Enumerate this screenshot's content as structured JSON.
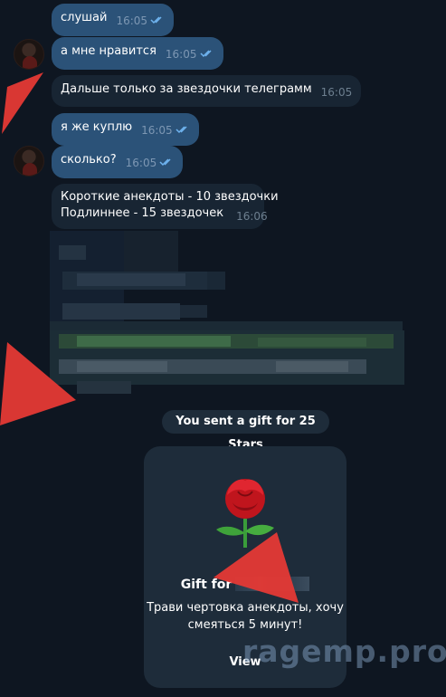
{
  "messages": [
    {
      "text": "слушай",
      "time": "16:05"
    },
    {
      "text": "а мне нравится",
      "time": "16:05"
    },
    {
      "text": "Дальше только за звездочки телеграмм",
      "time": "16:05"
    },
    {
      "text": "я же куплю",
      "time": "16:05"
    },
    {
      "text": "сколько?",
      "time": "16:05"
    },
    {
      "line1": "Короткие анекдоты - 10 звездочки",
      "line2": "Подлиннее - 15 звездочек",
      "time": "16:06"
    }
  ],
  "service_text": "You sent a gift for 25 Stars",
  "gift": {
    "title": "Gift for",
    "message": "Трави чертовка анекдоты, хочу\nсмеяться 5 минут!",
    "view_label": "View"
  },
  "watermark": "ragemp.pro",
  "colors": {
    "background": "#0e1621",
    "outgoing_bubble": "#2b5278",
    "incoming_bubble": "#182533",
    "arrow": "#e53935"
  }
}
